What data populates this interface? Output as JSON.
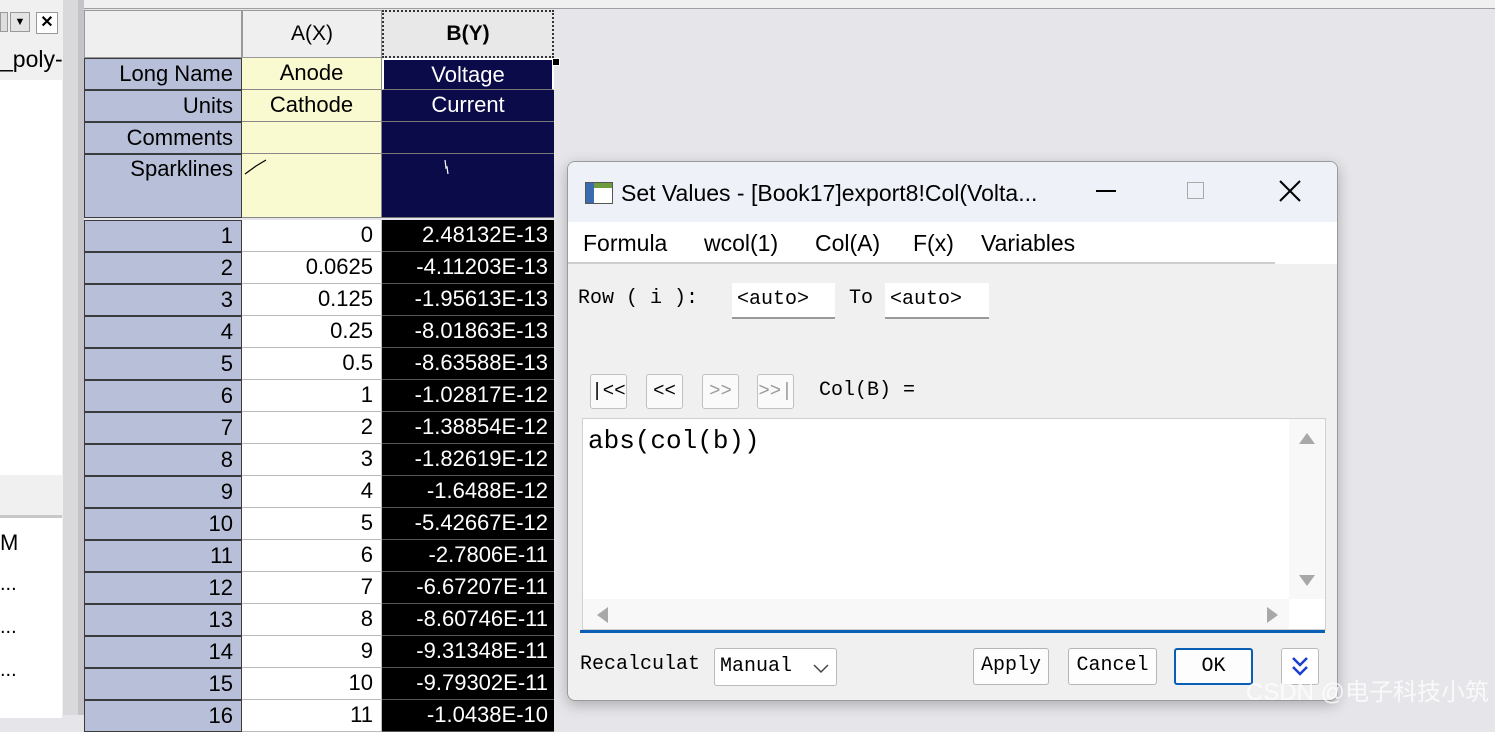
{
  "left_panel": {
    "tree_label": "_poly-",
    "list_header": "M",
    "list_items": [
      "...",
      "...",
      "..."
    ]
  },
  "worksheet": {
    "columns": [
      {
        "header": "A(X)",
        "long_name": "Anode",
        "units": "Cathode",
        "comments": ""
      },
      {
        "header": "B(Y)",
        "long_name": "Voltage",
        "units": "Current",
        "comments": ""
      }
    ],
    "label_rows": [
      "Long Name",
      "Units",
      "Comments",
      "Sparklines"
    ],
    "rows": [
      {
        "n": "1",
        "a": "0",
        "b": "2.48132E-13"
      },
      {
        "n": "2",
        "a": "0.0625",
        "b": "-4.11203E-13"
      },
      {
        "n": "3",
        "a": "0.125",
        "b": "-1.95613E-13"
      },
      {
        "n": "4",
        "a": "0.25",
        "b": "-8.01863E-13"
      },
      {
        "n": "5",
        "a": "0.5",
        "b": "-8.63588E-13"
      },
      {
        "n": "6",
        "a": "1",
        "b": "-1.02817E-12"
      },
      {
        "n": "7",
        "a": "2",
        "b": "-1.38854E-12"
      },
      {
        "n": "8",
        "a": "3",
        "b": "-1.82619E-12"
      },
      {
        "n": "9",
        "a": "4",
        "b": "-1.6488E-12"
      },
      {
        "n": "10",
        "a": "5",
        "b": "-5.42667E-12"
      },
      {
        "n": "11",
        "a": "6",
        "b": "-2.7806E-11"
      },
      {
        "n": "12",
        "a": "7",
        "b": "-6.67207E-11"
      },
      {
        "n": "13",
        "a": "8",
        "b": "-8.60746E-11"
      },
      {
        "n": "14",
        "a": "9",
        "b": "-9.31348E-11"
      },
      {
        "n": "15",
        "a": "10",
        "b": "-9.79302E-11"
      },
      {
        "n": "16",
        "a": "11",
        "b": "-1.0438E-10"
      }
    ]
  },
  "dialog": {
    "title": "Set Values - [Book17]export8!Col(Volta...",
    "menu": [
      "Formula",
      "wcol(1)",
      "Col(A)",
      "F(x)",
      "Variables"
    ],
    "row_label": "Row ( i ):",
    "row_from": "<auto>",
    "to_label": "To",
    "row_to": "<auto>",
    "nav_buttons": [
      "|<<",
      "<<",
      ">>",
      ">>|"
    ],
    "col_expr_label": "Col(B) =",
    "formula": "abs(col(b))",
    "recalculate_label": "Recalculat",
    "recalculate_value": "Manual",
    "apply_label": "Apply",
    "cancel_label": "Cancel",
    "ok_label": "OK",
    "accent_color": "#0a5fb4"
  },
  "watermark": "CSDN @电子科技小筑"
}
